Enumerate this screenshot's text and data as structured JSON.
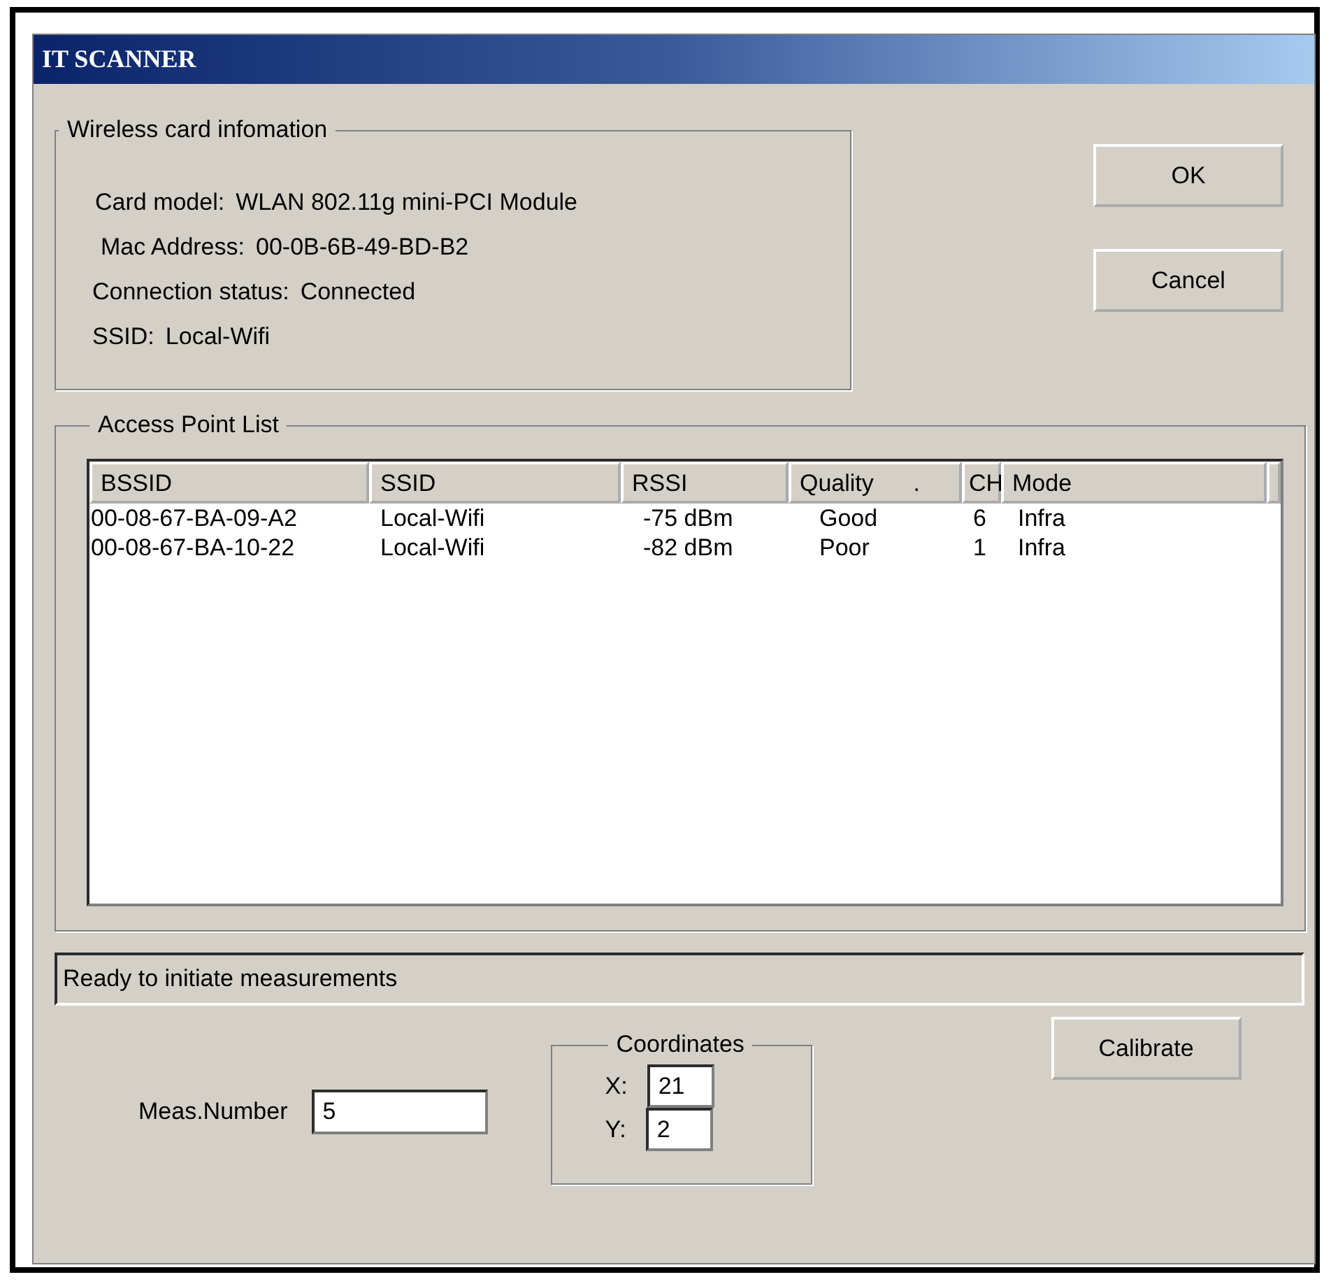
{
  "window": {
    "title": "IT SCANNER"
  },
  "card_info": {
    "title": "Wireless card infomation",
    "lines": [
      {
        "label": "Card model:",
        "value": "WLAN 802.11g mini-PCI Module"
      },
      {
        "label": "Mac Address:",
        "value": "00-0B-6B-49-BD-B2"
      },
      {
        "label": "Connection status:",
        "value": "Connected"
      },
      {
        "label": "SSID:",
        "value": "Local-Wifi"
      }
    ]
  },
  "buttons": [
    "OK",
    "Cancel"
  ],
  "access_points": {
    "title": "Access Point List",
    "columns": [
      "BSSID",
      "SSID",
      "RSSI",
      "Quality      .",
      "CH",
      "Mode"
    ],
    "rows": [
      [
        "00-08-67-BA-09-A2",
        "Local-Wifi",
        "-75 dBm",
        "Good",
        "6",
        "Infra"
      ],
      [
        "00-08-67-BA-10-22",
        "Local-Wifi",
        "-82 dBm",
        "Poor",
        "1",
        "Infra"
      ]
    ]
  },
  "status_bar": "Ready to initiate measurements",
  "calibrate_button": "Calibrate",
  "meas_number": {
    "label": "Meas.Number",
    "value": "5"
  },
  "coordinates": {
    "title": "Coordinates",
    "fields": [
      {
        "label": "X:",
        "value": "21"
      },
      {
        "label": "Y:",
        "value": "2"
      }
    ]
  }
}
